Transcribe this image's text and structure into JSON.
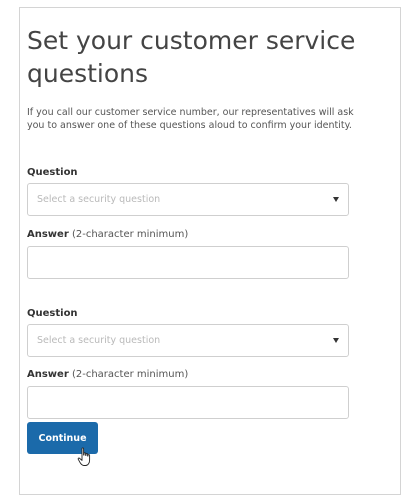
{
  "page": {
    "title": "Set your customer service questions",
    "intro": "If you call our customer service number, our representatives will ask you to answer one of these questions aloud to confirm your identity."
  },
  "form": {
    "question_label": "Question",
    "question_placeholder": "Select a security question",
    "answer_label": "Answer",
    "answer_hint": "(2-character minimum)",
    "pairs": [
      {
        "question_value": "",
        "answer_value": ""
      },
      {
        "question_value": "",
        "answer_value": ""
      }
    ],
    "continue_label": "Continue"
  },
  "icons": {
    "select_caret": "caret-down-icon",
    "pointer": "hand-pointer-cursor-icon"
  },
  "colors": {
    "accent": "#1b6aaa",
    "border": "#cfcfcf",
    "placeholder": "#b9b9b9"
  }
}
